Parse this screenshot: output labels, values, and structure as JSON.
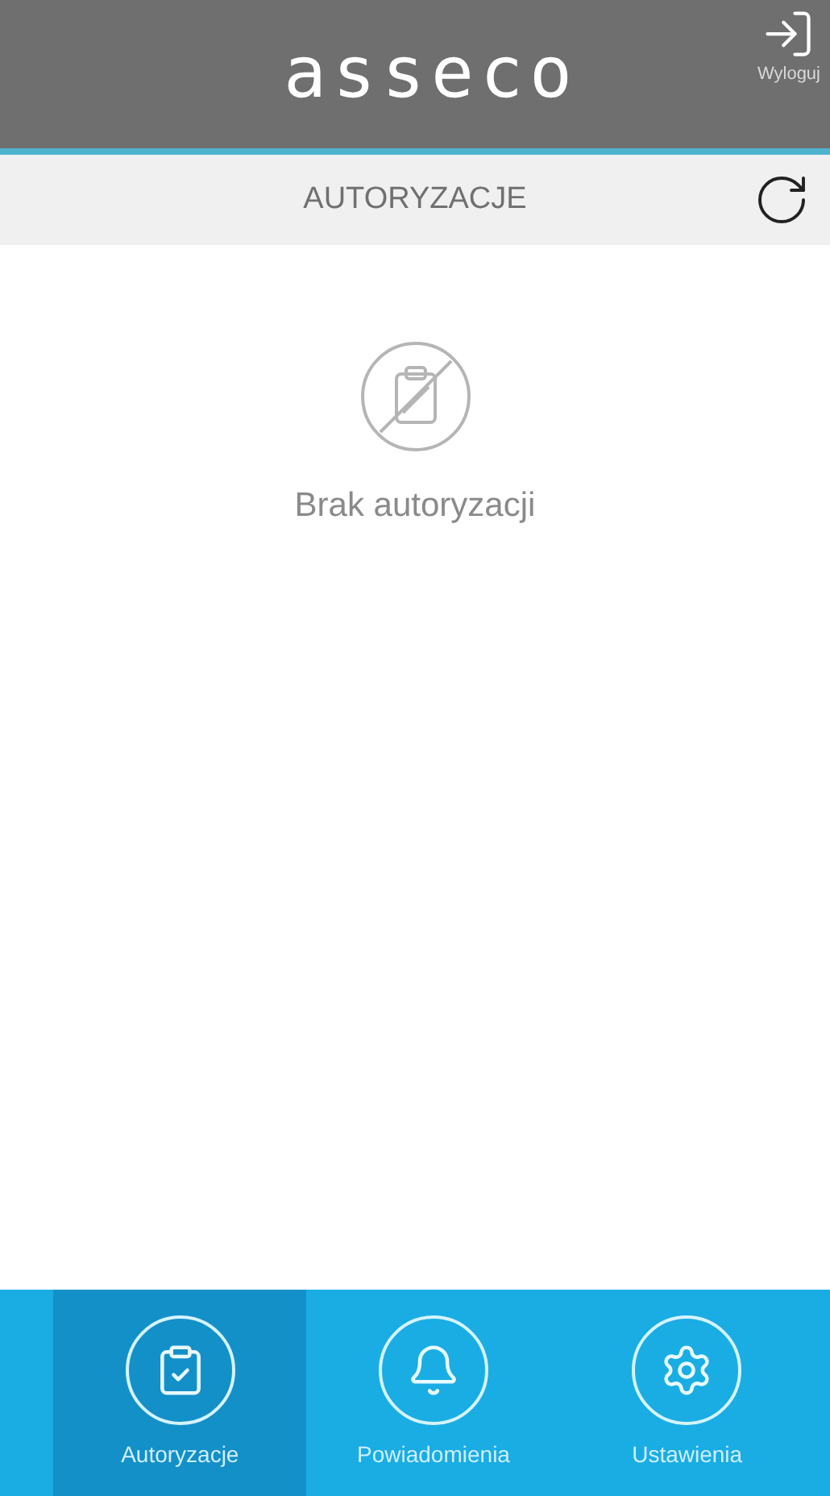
{
  "top_bar": {
    "logo": "asseco",
    "logout_label": "Wyloguj"
  },
  "header": {
    "title": "AUTORYZACJE"
  },
  "empty_state": {
    "message": "Brak autoryzacji"
  },
  "bottom_nav": [
    {
      "kind": "authorizations",
      "label": "Autoryzacje",
      "selected": true
    },
    {
      "kind": "notifications",
      "label": "Powiadomienia",
      "selected": false
    },
    {
      "kind": "settings",
      "label": "Ustawienia",
      "selected": false
    }
  ]
}
